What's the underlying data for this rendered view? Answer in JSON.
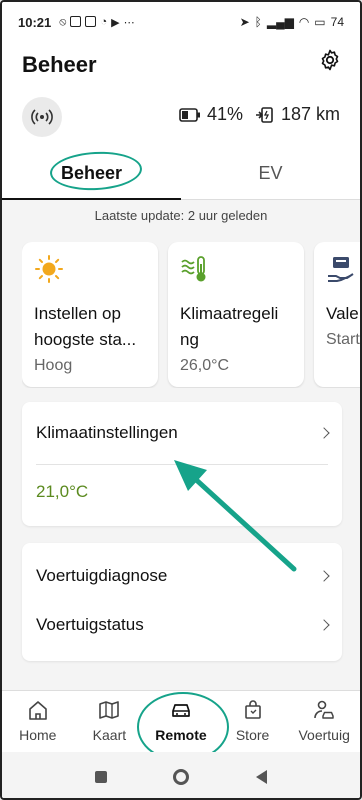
{
  "status_bar": {
    "time": "10:21",
    "battery": "74"
  },
  "header": {
    "title": "Beheer",
    "battery_pct": "41%",
    "range": "187 km"
  },
  "tabs": [
    {
      "label": "Beheer"
    },
    {
      "label": "EV"
    }
  ],
  "last_update": "Laatste update: 2 uur geleden",
  "cards": [
    {
      "label_line1": "Instellen op",
      "label_line2": "hoogste sta...",
      "sub": "Hoog"
    },
    {
      "label_line1": "Klimaatregeli",
      "label_line2": "ng",
      "sub": "26,0°C"
    },
    {
      "label_line1": "Vale",
      "label_line2": "",
      "sub": "Start"
    }
  ],
  "climate": {
    "title": "Klimaatinstellingen",
    "temperature": "21,0°C"
  },
  "vehicle_rows": [
    {
      "label": "Voertuigdiagnose"
    },
    {
      "label": "Voertuigstatus"
    }
  ],
  "bottom_nav": [
    {
      "label": "Home",
      "icon": "home-icon"
    },
    {
      "label": "Kaart",
      "icon": "map-icon"
    },
    {
      "label": "Remote",
      "icon": "car-icon"
    },
    {
      "label": "Store",
      "icon": "shopping-bag-icon"
    },
    {
      "label": "Voertuig",
      "icon": "vehicle-user-icon"
    }
  ],
  "colors": {
    "accent_annotation": "#16a38a",
    "temperature_text": "#5b8a1f",
    "sun_icon": "#f2a81d",
    "thermo_icon": "#5aa02c"
  }
}
